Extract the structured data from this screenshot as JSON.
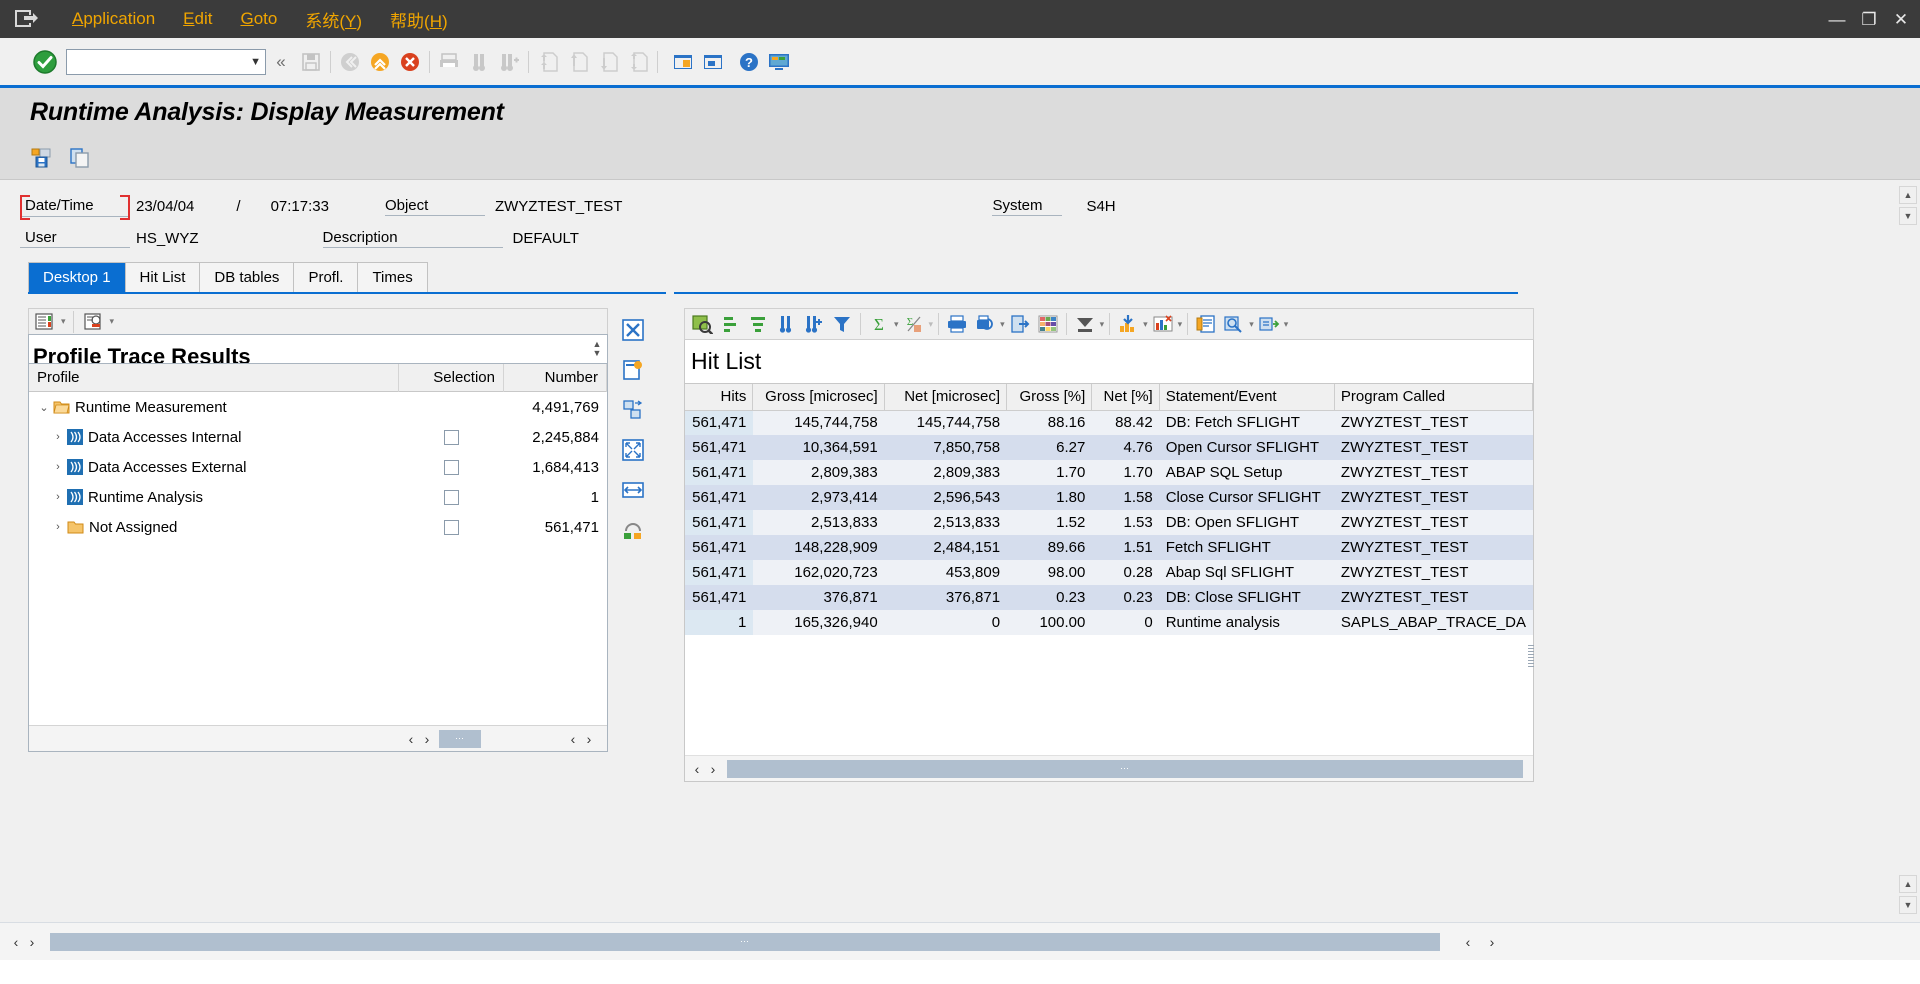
{
  "menu": {
    "system_icon": "window-menu-icon",
    "items": [
      {
        "label": "Application",
        "accel": "A"
      },
      {
        "label": "Edit",
        "accel": "E"
      },
      {
        "label": "Goto",
        "accel": "G"
      },
      {
        "label": "系统(Y)",
        "accel": "Y"
      },
      {
        "label": "帮助(H)",
        "accel": "H"
      }
    ],
    "window_buttons": [
      "—",
      "❐",
      "✕"
    ]
  },
  "toolbar": {
    "ok_icon": "green-check-icon",
    "command_value": "",
    "command_placeholder": "",
    "dropdown_icon": "chevron-down-icon",
    "buttons": [
      {
        "name": "enter-more-icon",
        "glyph": "«"
      },
      {
        "name": "save-icon"
      },
      {
        "name": "back-icon"
      },
      {
        "name": "exit-icon"
      },
      {
        "name": "cancel-icon"
      },
      {
        "name": "print-icon"
      },
      {
        "name": "find-icon"
      },
      {
        "name": "find-next-icon"
      },
      {
        "name": "first-page-icon"
      },
      {
        "name": "previous-page-icon"
      },
      {
        "name": "next-page-icon"
      },
      {
        "name": "last-page-icon"
      },
      {
        "name": "create-session-icon"
      },
      {
        "name": "create-shortcut-icon"
      },
      {
        "name": "help-icon"
      },
      {
        "name": "customize-local-layout-icon"
      }
    ]
  },
  "page": {
    "title": "Runtime Analysis: Display Measurement",
    "app_toolbar": [
      {
        "name": "save-measurement-icon"
      },
      {
        "name": "copy-icon"
      }
    ]
  },
  "header": {
    "datetime_label": "Date/Time",
    "date_value": "23/04/04",
    "separator": "/",
    "time_value": "07:17:33",
    "object_label": "Object",
    "object_value": "ZWYZTEST_TEST",
    "system_label": "System",
    "system_value": "S4H",
    "user_label": "User",
    "user_value": "HS_WYZ",
    "description_label": "Description",
    "description_value": "DEFAULT"
  },
  "tabs": [
    {
      "label": "Desktop 1",
      "active": true
    },
    {
      "label": "Hit List",
      "active": false
    },
    {
      "label": "DB tables",
      "active": false
    },
    {
      "label": "Profl.",
      "active": false
    },
    {
      "label": "Times",
      "active": false
    }
  ],
  "left_panel": {
    "mini_toolbar": [
      {
        "name": "detail-list-icon"
      },
      {
        "name": "display-variant-icon"
      }
    ],
    "title": "Profile Trace Results",
    "spinner_icon": "spinner-up-down-icon",
    "columns": [
      "Profile",
      "Selection",
      "Number"
    ],
    "rows": [
      {
        "indent": 0,
        "twisty": "expanded",
        "icon": "folder-open-icon",
        "label": "Runtime Measurement",
        "selection": null,
        "number": "4,491,769"
      },
      {
        "indent": 1,
        "twisty": "collapsed",
        "icon": "data-access-icon",
        "label": "Data Accesses Internal",
        "selection": "unchecked",
        "number": "2,245,884"
      },
      {
        "indent": 1,
        "twisty": "collapsed",
        "icon": "data-access-icon",
        "label": "Data Accesses External",
        "selection": "unchecked",
        "number": "1,684,413"
      },
      {
        "indent": 1,
        "twisty": "collapsed",
        "icon": "data-access-icon",
        "label": "Runtime Analysis",
        "selection": "unchecked",
        "number": "1"
      },
      {
        "indent": 1,
        "twisty": "collapsed",
        "icon": "folder-closed-icon",
        "label": "Not Assigned",
        "selection": "unchecked",
        "number": "561,471"
      }
    ],
    "scroll": {
      "left_arrow": "‹",
      "right_arrow": "›",
      "thumb_glyph": "⋯"
    },
    "side_tools": [
      {
        "name": "close-panel-icon"
      },
      {
        "name": "new-desktop-icon"
      },
      {
        "name": "swap-panel-icon"
      },
      {
        "name": "maximize-panel-icon"
      },
      {
        "name": "split-horizontal-icon"
      },
      {
        "name": "refresh-panel-icon"
      }
    ]
  },
  "right_panel": {
    "toolbar": [
      {
        "name": "details-icon"
      },
      {
        "name": "sort-ascending-icon"
      },
      {
        "name": "sort-descending-icon"
      },
      {
        "name": "find-icon"
      },
      {
        "name": "find-next-icon"
      },
      {
        "name": "filter-icon"
      },
      {
        "name": "total-icon"
      },
      {
        "name": "subtotal-icon"
      },
      {
        "name": "print-icon"
      },
      {
        "name": "print-preview-icon"
      },
      {
        "name": "export-icon"
      },
      {
        "name": "microsoft-excel-icon"
      },
      {
        "name": "view-selection-icon"
      },
      {
        "name": "download-icon"
      },
      {
        "name": "graphic-icon"
      },
      {
        "name": "abap-list-icon"
      },
      {
        "name": "info-icon"
      },
      {
        "name": "layout-icon"
      }
    ],
    "title": "Hit List",
    "columns": [
      "Hits",
      "Gross [microsec]",
      "Net [microsec]",
      "Gross [%]",
      "Net [%]",
      "Statement/Event",
      "Program Called"
    ],
    "rows": [
      [
        "561,471",
        "145,744,758",
        "145,744,758",
        "88.16",
        "88.42",
        "DB: Fetch SFLIGHT",
        "ZWYZTEST_TEST"
      ],
      [
        "561,471",
        "10,364,591",
        "7,850,758",
        "6.27",
        "4.76",
        "Open Cursor SFLIGHT",
        "ZWYZTEST_TEST"
      ],
      [
        "561,471",
        "2,809,383",
        "2,809,383",
        "1.70",
        "1.70",
        "ABAP SQL Setup",
        "ZWYZTEST_TEST"
      ],
      [
        "561,471",
        "2,973,414",
        "2,596,543",
        "1.80",
        "1.58",
        "Close Cursor SFLIGHT",
        "ZWYZTEST_TEST"
      ],
      [
        "561,471",
        "2,513,833",
        "2,513,833",
        "1.52",
        "1.53",
        "DB: Open SFLIGHT",
        "ZWYZTEST_TEST"
      ],
      [
        "561,471",
        "148,228,909",
        "2,484,151",
        "89.66",
        "1.51",
        "Fetch SFLIGHT",
        "ZWYZTEST_TEST"
      ],
      [
        "561,471",
        "162,020,723",
        "453,809",
        "98.00",
        "0.28",
        "Abap Sql SFLIGHT",
        "ZWYZTEST_TEST"
      ],
      [
        "561,471",
        "376,871",
        "376,871",
        "0.23",
        "0.23",
        "DB: Close SFLIGHT",
        "ZWYZTEST_TEST"
      ],
      [
        "1",
        "165,326,940",
        "0",
        "100.00",
        "0",
        "Runtime analysis",
        "SAPLS_ABAP_TRACE_DA"
      ]
    ],
    "scroll": {
      "left_arrow": "‹",
      "right_arrow": "›",
      "thumb_glyph": "⋯"
    }
  },
  "status": {
    "left_arrow": "‹",
    "right_arrow": "›",
    "thumb_glyph": "⋯"
  },
  "colors": {
    "accent": "#0a6ed1",
    "menu_text": "#f0a500",
    "menu_bg": "#3b3b3b",
    "focus_red": "#e03030",
    "row_alt": "#d5dded",
    "scroll_thumb": "#b0bfcf"
  }
}
